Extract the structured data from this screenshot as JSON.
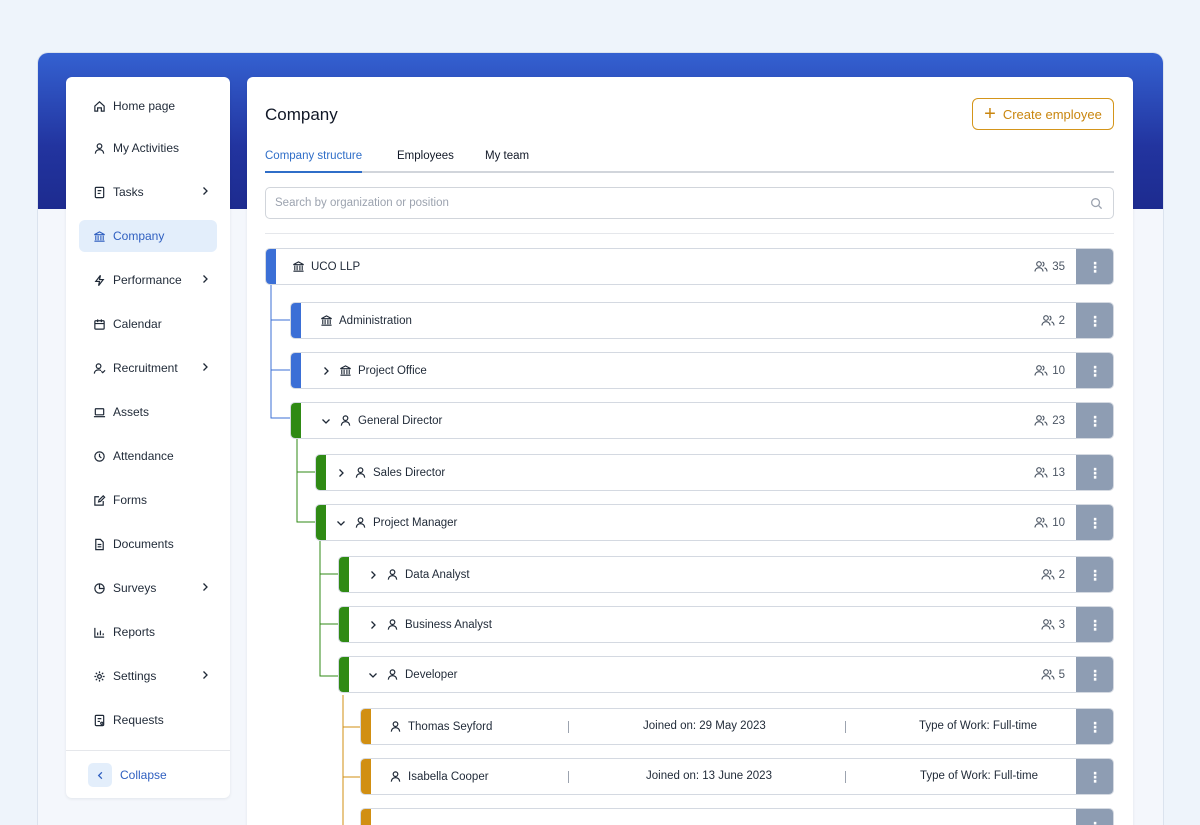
{
  "colors": {
    "accent_blue": "#3b6fd6",
    "accent_green": "#2f8a14",
    "accent_orange": "#d18f12",
    "more_button": "#8e9db3"
  },
  "sidebar": {
    "items": [
      {
        "label": "Home page",
        "icon": "home-icon"
      },
      {
        "label": "My Activities",
        "icon": "user-icon"
      },
      {
        "label": "Tasks",
        "icon": "tasks-icon",
        "expandable": true
      },
      {
        "label": "Company",
        "icon": "bank-icon",
        "active": true
      },
      {
        "label": "Performance",
        "icon": "bolt-icon",
        "expandable": true
      },
      {
        "label": "Calendar",
        "icon": "calendar-icon"
      },
      {
        "label": "Recruitment",
        "icon": "recruit-icon",
        "expandable": true
      },
      {
        "label": "Assets",
        "icon": "laptop-icon"
      },
      {
        "label": "Attendance",
        "icon": "clock-icon"
      },
      {
        "label": "Forms",
        "icon": "edit-icon"
      },
      {
        "label": "Documents",
        "icon": "document-icon"
      },
      {
        "label": "Surveys",
        "icon": "pie-icon",
        "expandable": true
      },
      {
        "label": "Reports",
        "icon": "bar-chart-icon"
      },
      {
        "label": "Settings",
        "icon": "gear-icon",
        "expandable": true
      },
      {
        "label": "Requests",
        "icon": "request-icon"
      }
    ],
    "collapse_label": "Collapse"
  },
  "main": {
    "title": "Company",
    "create_button": "Create employee",
    "tabs": [
      {
        "label": "Company structure",
        "active": true
      },
      {
        "label": "Employees"
      },
      {
        "label": "My team"
      }
    ],
    "search_placeholder": "Search by organization or position",
    "nodes": [
      {
        "name": "UCO LLP",
        "count": "35",
        "type": "org"
      },
      {
        "name": "Administration",
        "count": "2",
        "type": "org"
      },
      {
        "name": "Project Office",
        "count": "10",
        "type": "org",
        "caret": "right"
      },
      {
        "name": "General Director",
        "count": "23",
        "type": "position",
        "caret": "down"
      },
      {
        "name": "Sales Director",
        "count": "13",
        "type": "position",
        "caret": "right"
      },
      {
        "name": "Project Manager",
        "count": "10",
        "type": "position",
        "caret": "down"
      },
      {
        "name": "Data Analyst",
        "count": "2",
        "type": "position",
        "caret": "right"
      },
      {
        "name": "Business Analyst",
        "count": "3",
        "type": "position",
        "caret": "right"
      },
      {
        "name": "Developer",
        "count": "5",
        "type": "position",
        "caret": "down"
      }
    ],
    "employees": [
      {
        "name": "Thomas Seyford",
        "joined": "Joined on: 29 May 2023",
        "work": "Type of Work: Full-time"
      },
      {
        "name": "Isabella Cooper",
        "joined": "Joined on: 13 June 2023",
        "work": "Type of Work: Full-time"
      }
    ]
  }
}
